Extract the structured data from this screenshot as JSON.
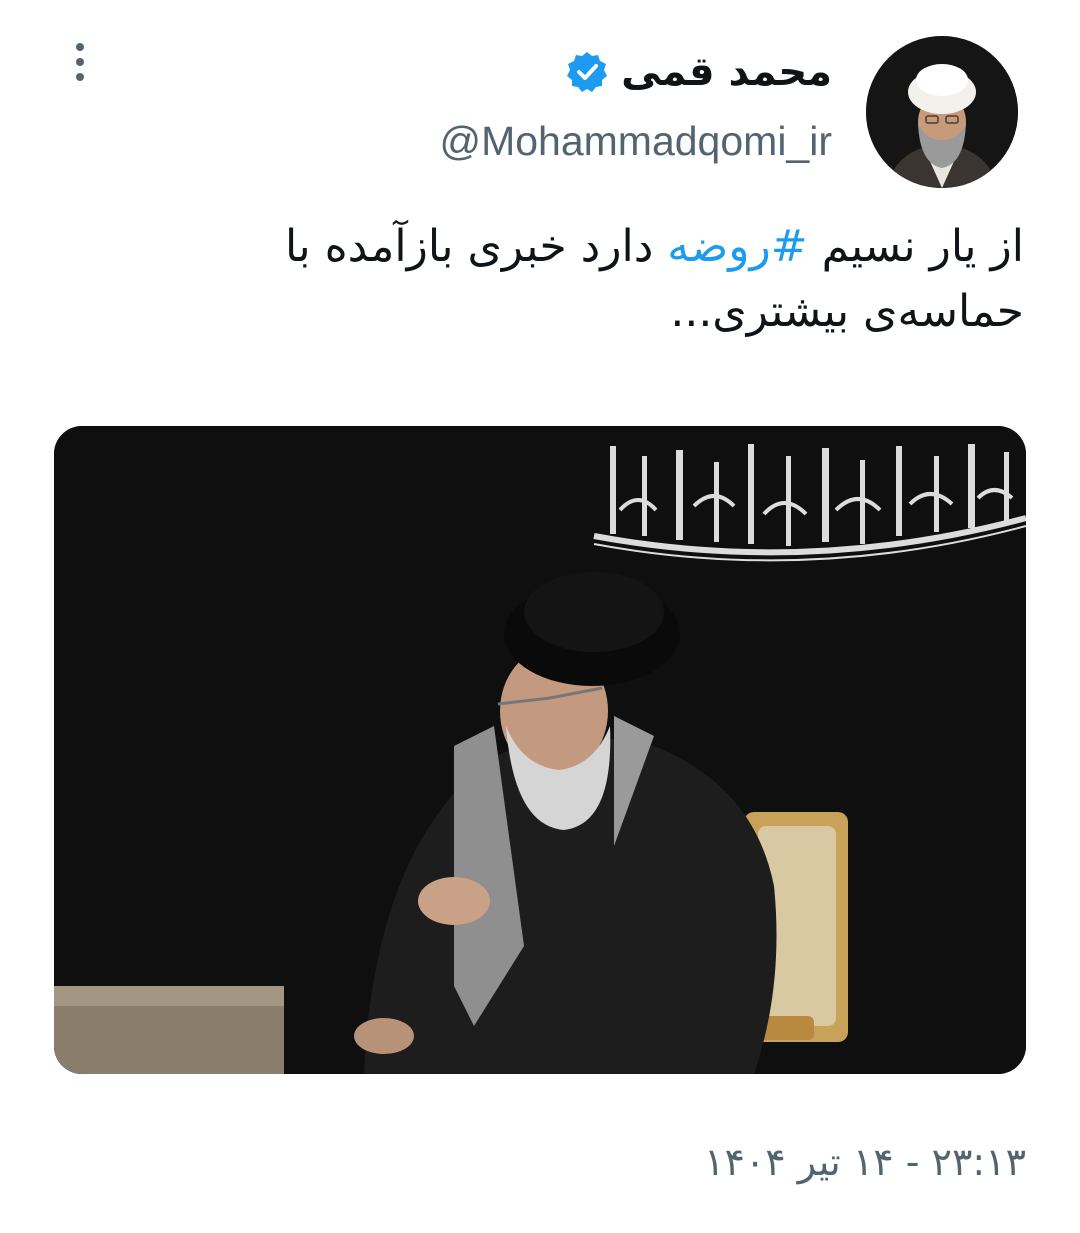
{
  "author": {
    "display_name": "محمد قمی",
    "handle": "@Mohammadqomi_ir",
    "verified": true
  },
  "tweet": {
    "text_before_hashtag": "از یار نسیم ",
    "hashtag": "#روضه",
    "text_after_hashtag": " دارد خبری بازآمده با حماسه‌ی بیشتری...",
    "timestamp": "۲۳:۱۳ - ۱۴ تیر ۱۴۰۴"
  },
  "icons": {
    "more": "more-vertical-icon",
    "verified": "verified-badge-icon"
  },
  "colors": {
    "text": "#0f1419",
    "secondary": "#536471",
    "accent": "#1d9bf0"
  }
}
